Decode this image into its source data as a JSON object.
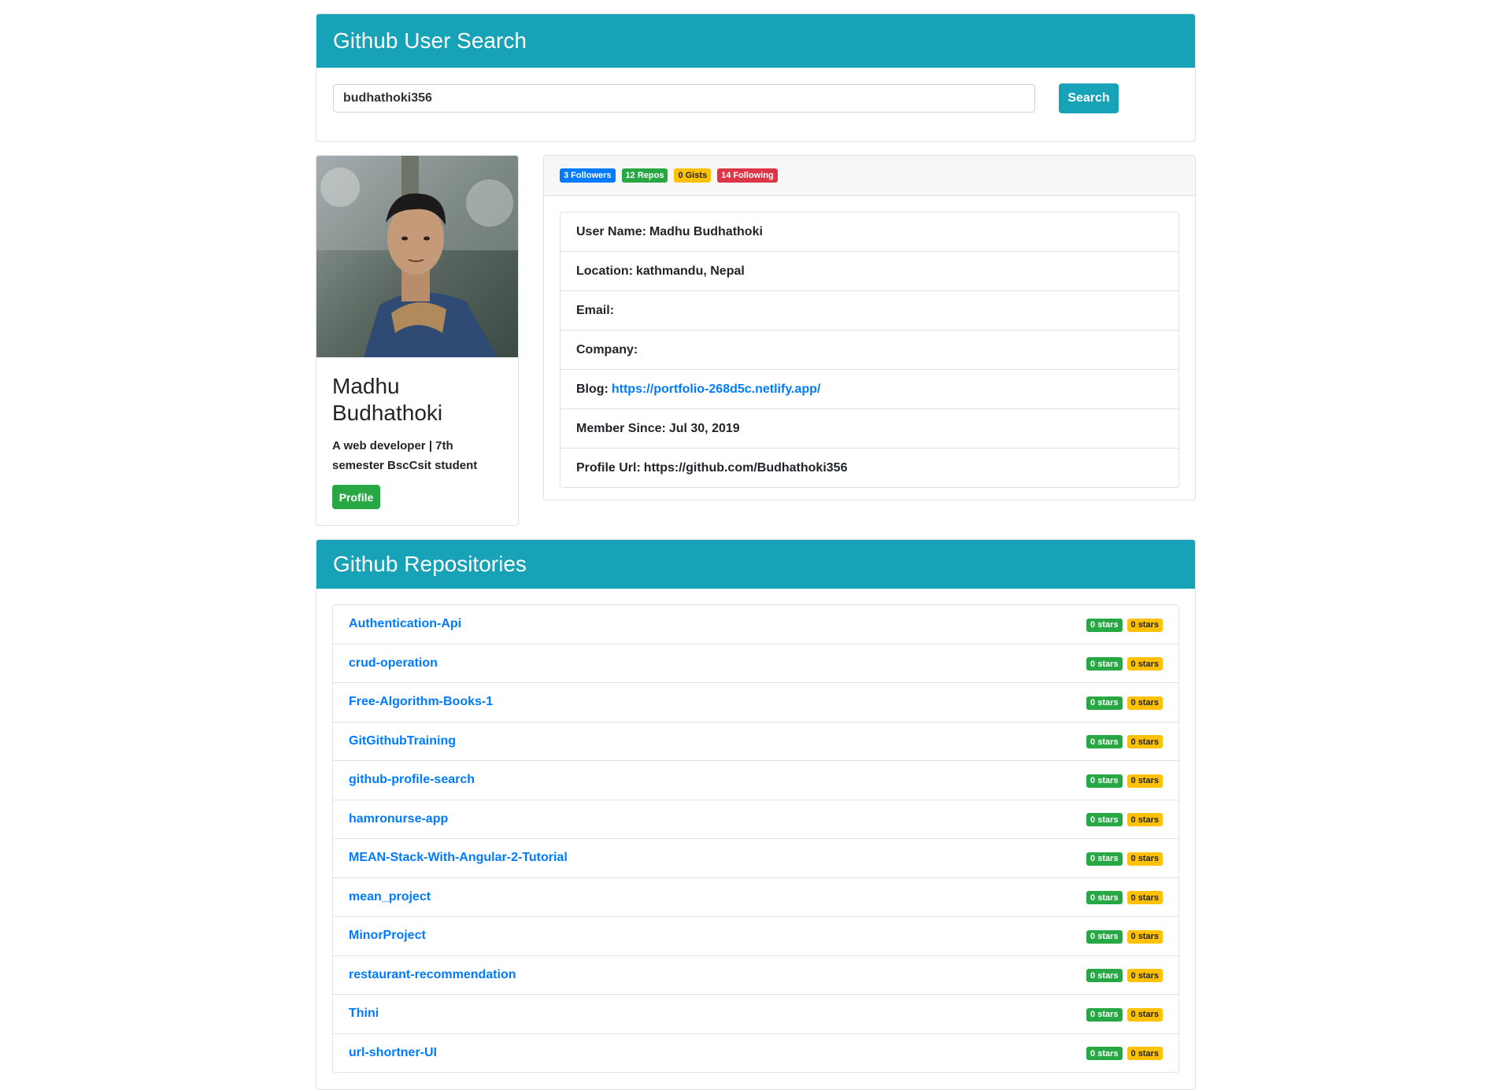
{
  "app": {
    "title": "Github User Search"
  },
  "search": {
    "value": "budhathoki356",
    "button_label": "Search"
  },
  "profile": {
    "name": "Madhu Budhathoki",
    "bio": "A web developer | 7th semester BscCsit student",
    "profile_button": "Profile",
    "badges": {
      "followers": "3 Followers",
      "repos": "12 Repos",
      "gists": "0 Gists",
      "following": "14 Following"
    },
    "details": {
      "username_label": "User Name:",
      "username": "Madhu Budhathoki",
      "location_label": "Location:",
      "location": "kathmandu, Nepal",
      "email_label": "Email:",
      "email": "",
      "company_label": "Company:",
      "company": "",
      "blog_label": "Blog:",
      "blog": "https://portfolio-268d5c.netlify.app/",
      "member_since_label": "Member Since:",
      "member_since": "Jul 30, 2019",
      "profile_url_label": "Profile Url:",
      "profile_url": "https://github.com/Budhathoki356"
    }
  },
  "repos": {
    "title": "Github Repositories",
    "items": [
      {
        "name": "Authentication-Api",
        "stars": "0 stars",
        "watchers": "0 stars"
      },
      {
        "name": "crud-operation",
        "stars": "0 stars",
        "watchers": "0 stars"
      },
      {
        "name": "Free-Algorithm-Books-1",
        "stars": "0 stars",
        "watchers": "0 stars"
      },
      {
        "name": "GitGithubTraining",
        "stars": "0 stars",
        "watchers": "0 stars"
      },
      {
        "name": "github-profile-search",
        "stars": "0 stars",
        "watchers": "0 stars"
      },
      {
        "name": "hamronurse-app",
        "stars": "0 stars",
        "watchers": "0 stars"
      },
      {
        "name": "MEAN-Stack-With-Angular-2-Tutorial",
        "stars": "0 stars",
        "watchers": "0 stars"
      },
      {
        "name": "mean_project",
        "stars": "0 stars",
        "watchers": "0 stars"
      },
      {
        "name": "MinorProject",
        "stars": "0 stars",
        "watchers": "0 stars"
      },
      {
        "name": "restaurant-recommendation",
        "stars": "0 stars",
        "watchers": "0 stars"
      },
      {
        "name": "Thini",
        "stars": "0 stars",
        "watchers": "0 stars"
      },
      {
        "name": "url-shortner-UI",
        "stars": "0 stars",
        "watchers": "0 stars"
      }
    ]
  },
  "colors": {
    "primary": "#17a2b8",
    "link": "#007bff",
    "success": "#28a745",
    "warning": "#ffc107",
    "danger": "#dc3545"
  }
}
